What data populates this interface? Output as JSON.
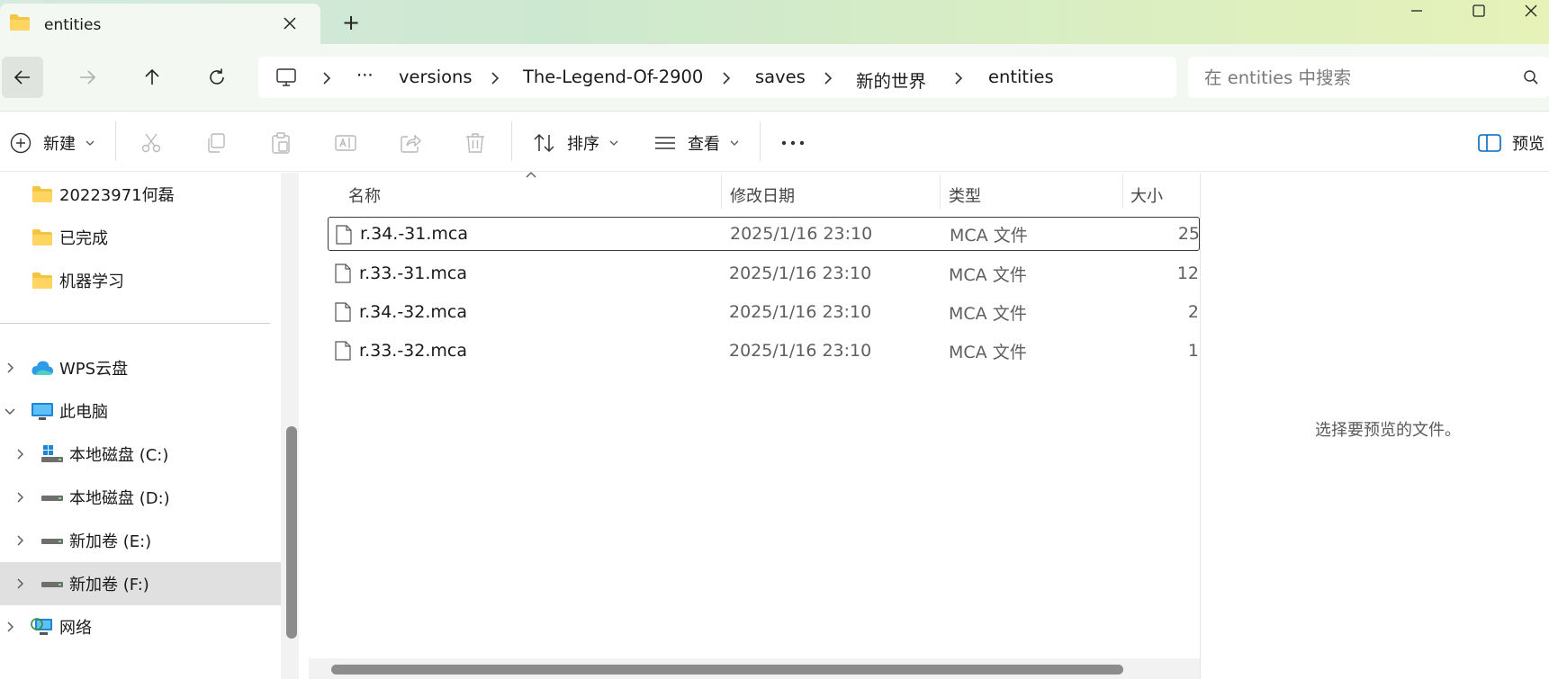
{
  "window": {
    "tab_title": "entities",
    "new_tab_label": "+"
  },
  "address_bar": {
    "overflow": "···",
    "crumbs": [
      "versions",
      "The-Legend-Of-2900",
      "saves",
      "新的世界",
      "entities"
    ]
  },
  "search": {
    "placeholder": "在 entities 中搜索"
  },
  "commands": {
    "new_label": "新建",
    "sort_label": "排序",
    "view_label": "查看",
    "preview_label": "预览"
  },
  "nav": {
    "quick_items": [
      "20223971何磊",
      "已完成",
      "机器学习"
    ],
    "wps": "WPS云盘",
    "this_pc": "此电脑",
    "drive_c": "本地磁盘 (C:)",
    "drive_d": "本地磁盘 (D:)",
    "drive_e": "新加卷 (E:)",
    "drive_f": "新加卷 (F:)",
    "network": "网络"
  },
  "columns": {
    "name": "名称",
    "date": "修改日期",
    "type": "类型",
    "size": "大小"
  },
  "files": [
    {
      "name": "r.34.-31.mca",
      "date": "2025/1/16 23:10",
      "type": "MCA 文件",
      "size": "25"
    },
    {
      "name": "r.33.-31.mca",
      "date": "2025/1/16 23:10",
      "type": "MCA 文件",
      "size": "12"
    },
    {
      "name": "r.34.-32.mca",
      "date": "2025/1/16 23:10",
      "type": "MCA 文件",
      "size": "2"
    },
    {
      "name": "r.33.-32.mca",
      "date": "2025/1/16 23:10",
      "type": "MCA 文件",
      "size": "1"
    }
  ],
  "preview": {
    "message": "选择要预览的文件。"
  },
  "colors": {
    "folder": "#f4c542",
    "accent": "#0067c0",
    "selected_row": "#e0e0e0",
    "scroll_thumb": "#8c8c8c"
  }
}
